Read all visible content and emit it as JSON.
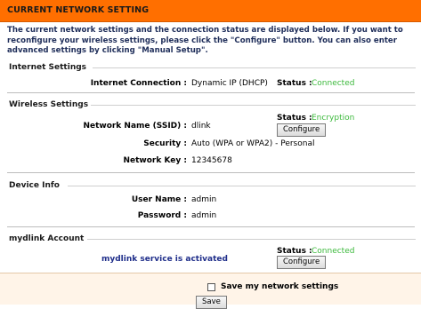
{
  "header": {
    "title": "CURRENT NETWORK SETTING"
  },
  "intro": "The current network settings and the connection status are displayed below. If you want to reconfigure your wireless settings, please click the \"Configure\" button. You can also enter advanced settings by clicking \"Manual Setup\".",
  "internet": {
    "section_title": "Internet Settings",
    "connection_label": "Internet Connection :",
    "connection_value": "Dynamic IP (DHCP)",
    "status_label": "Status :",
    "status_value": "Connected"
  },
  "wireless": {
    "section_title": "Wireless Settings",
    "ssid_label": "Network Name (SSID) :",
    "ssid_value": "dlink",
    "status_label": "Status :",
    "status_value": "Encryption",
    "configure_label": "Configure",
    "security_label": "Security :",
    "security_value": "Auto (WPA or WPA2) - Personal",
    "key_label": "Network Key :",
    "key_value": "12345678"
  },
  "device": {
    "section_title": "Device Info",
    "user_label": "User Name :",
    "user_value": "admin",
    "password_label": "Password :",
    "password_value": "admin"
  },
  "mydlink": {
    "section_title": "mydlink Account",
    "service_text": "mydlink service is activated",
    "status_label": "Status :",
    "status_value": "Connected",
    "configure_label": "Configure"
  },
  "footer": {
    "save_checkbox_label": "Save my network settings",
    "save_checked": false,
    "save_button": "Save"
  },
  "colors": {
    "header_bg": "#ff6f00",
    "status_green": "#3cb93c",
    "intro_text": "#1f2e5a",
    "service_text": "#1f2e8a"
  }
}
